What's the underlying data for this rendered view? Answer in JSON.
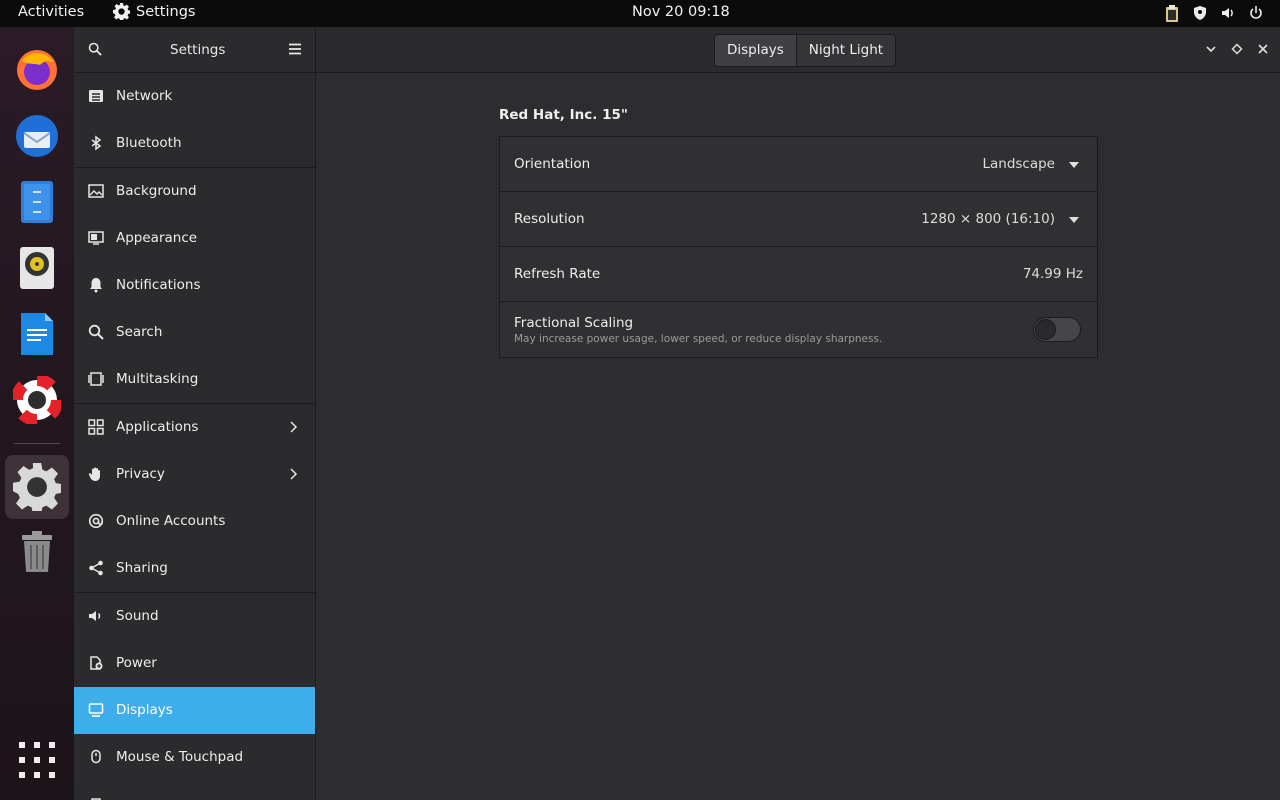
{
  "topbar": {
    "activities": "Activities",
    "app_name": "Settings",
    "clock": "Nov 20  09:18",
    "tray_icons": [
      "clipboard-icon",
      "shield-icon",
      "volume-icon",
      "power-icon"
    ]
  },
  "dock": {
    "items": [
      "firefox-icon",
      "thunderbird-icon",
      "files-icon",
      "rhythmbox-icon",
      "writer-icon",
      "help-icon",
      "settings-icon",
      "trash-icon",
      "app-grid-icon"
    ]
  },
  "header": {
    "title": "Settings",
    "tabs": [
      {
        "label": "Displays"
      },
      {
        "label": "Night Light"
      }
    ]
  },
  "sidebar": {
    "items": [
      {
        "label": "Network",
        "icon": "network-icon"
      },
      {
        "label": "Bluetooth",
        "icon": "bluetooth-icon"
      },
      {
        "label": "Background",
        "icon": "background-icon"
      },
      {
        "label": "Appearance",
        "icon": "appearance-icon"
      },
      {
        "label": "Notifications",
        "icon": "bell-icon"
      },
      {
        "label": "Search",
        "icon": "search-icon"
      },
      {
        "label": "Multitasking",
        "icon": "multitasking-icon"
      },
      {
        "label": "Applications",
        "icon": "grid-icon"
      },
      {
        "label": "Privacy",
        "icon": "hand-icon"
      },
      {
        "label": "Online Accounts",
        "icon": "at-icon"
      },
      {
        "label": "Sharing",
        "icon": "share-icon"
      },
      {
        "label": "Sound",
        "icon": "speaker-icon"
      },
      {
        "label": "Power",
        "icon": "power-plug-icon"
      },
      {
        "label": "Displays",
        "icon": "monitor-icon"
      },
      {
        "label": "Mouse & Touchpad",
        "icon": "mouse-icon"
      }
    ],
    "selected": "Displays",
    "accent": "#3daee9"
  },
  "main": {
    "monitor_name": "Red Hat, Inc. 15\"",
    "orientation": {
      "label": "Orientation",
      "value": "Landscape"
    },
    "resolution": {
      "label": "Resolution",
      "value": "1280 × 800 (16:10)"
    },
    "refresh": {
      "label": "Refresh Rate",
      "value": "74.99 Hz"
    },
    "scaling": {
      "label": "Fractional Scaling",
      "description": "May increase power usage, lower speed, or reduce display sharpness.",
      "enabled": false
    }
  }
}
